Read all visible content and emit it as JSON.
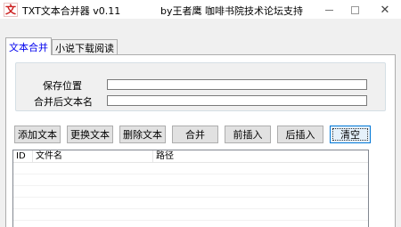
{
  "window": {
    "title": "TXT文本合并器 v0.11",
    "credit": "by王者鹰 咖啡书院技术论坛支持",
    "icon": "app-logo-icon",
    "icon_glyph": "文",
    "controls": {
      "minimize": "minimize-icon",
      "maximize": "maximize-icon",
      "close_glyph": "✕"
    }
  },
  "tabs": [
    {
      "label": "文本合并",
      "active": true
    },
    {
      "label": "小说下载阅读",
      "active": false
    }
  ],
  "form": {
    "save_location_label": "保存位置",
    "save_location_value": "",
    "merged_name_label": "合并后文本名",
    "merged_name_value": ""
  },
  "buttons": {
    "add_text": "添加文本",
    "replace_text": "更换文本",
    "delete_text": "删除文本",
    "merge": "合并",
    "insert_before": "前插入",
    "insert_after": "后插入",
    "clear": "清空"
  },
  "list": {
    "columns": [
      "ID",
      "文件名",
      "路径"
    ],
    "rows": []
  },
  "colors": {
    "active_tab_text": "#0000ee",
    "icon_red": "#cc1f1f",
    "focus_border": "#0078d7"
  }
}
